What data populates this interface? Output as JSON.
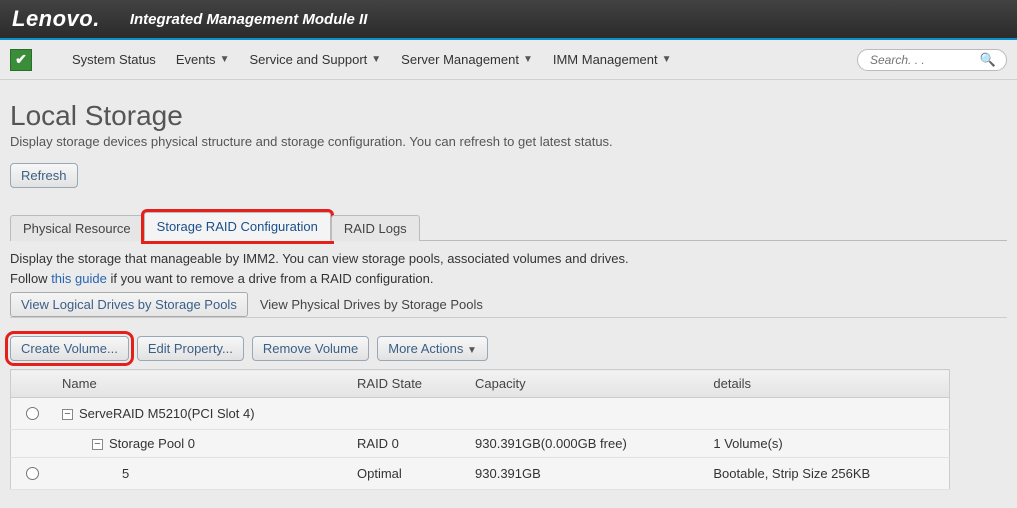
{
  "header": {
    "brand": "Lenovo.",
    "product": "Integrated Management Module II"
  },
  "menu": {
    "system_status": "System Status",
    "events": "Events",
    "service_support": "Service and Support",
    "server_mgmt": "Server Management",
    "imm_mgmt": "IMM Management",
    "search_placeholder": "Search. . ."
  },
  "page": {
    "title": "Local Storage",
    "subtitle": "Display storage devices physical structure and storage configuration. You can refresh to get latest status.",
    "refresh": "Refresh"
  },
  "tabs": {
    "physical": "Physical Resource",
    "raid_config": "Storage RAID Configuration",
    "raid_logs": "RAID Logs"
  },
  "panel": {
    "desc1": "Display the storage that manageable by IMM2. You can view storage pools, associated volumes and drives.",
    "desc2_pre": "Follow ",
    "desc2_link": "this guide",
    "desc2_post": " if you want to remove a drive from a RAID configuration.",
    "view_logical": "View Logical Drives by Storage Pools",
    "view_physical": "View Physical Drives by Storage Pools"
  },
  "actions": {
    "create_volume": "Create Volume...",
    "edit_property": "Edit Property...",
    "remove_volume": "Remove Volume",
    "more_actions": "More Actions"
  },
  "table": {
    "headers": {
      "name": "Name",
      "raid_state": "RAID State",
      "capacity": "Capacity",
      "details": "details"
    },
    "rows": [
      {
        "name": "ServeRAID M5210(PCI Slot 4)",
        "raid_state": "",
        "capacity": "",
        "details": "",
        "radio": true,
        "level": 0
      },
      {
        "name": "Storage Pool 0",
        "raid_state": "RAID 0",
        "capacity": "930.391GB(0.000GB free)",
        "details": "1 Volume(s)",
        "radio": false,
        "level": 1
      },
      {
        "name": "5",
        "raid_state": "Optimal",
        "capacity": "930.391GB",
        "details": "Bootable, Strip Size 256KB",
        "radio": true,
        "level": 2
      }
    ]
  }
}
